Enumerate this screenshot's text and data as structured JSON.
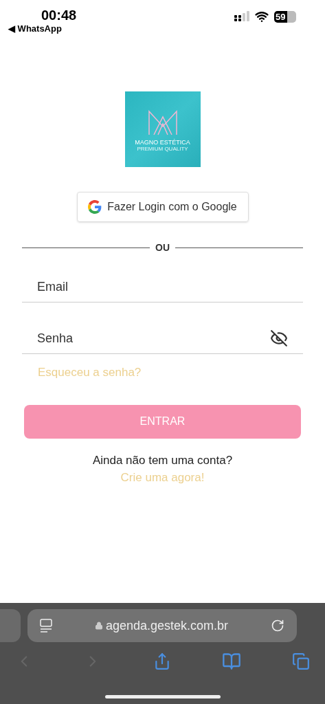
{
  "status_bar": {
    "time": "00:48",
    "back_app": "◀ WhatsApp",
    "battery": "59"
  },
  "logo": {
    "name": "MAGNO ESTÉTICA",
    "tagline": "PREMIUM QUALITY"
  },
  "google_button": {
    "label": "Fazer Login com o Google"
  },
  "divider": {
    "label": "OU"
  },
  "email_field": {
    "placeholder": "Email"
  },
  "password_field": {
    "placeholder": "Senha",
    "password_visible": false
  },
  "forgot_link": "Esqueceu a senha?",
  "submit_button": {
    "label": "ENTRAR",
    "disabled": true
  },
  "signup": {
    "prompt": "Ainda não tem uma conta?",
    "link": "Crie uma agora!"
  },
  "browser": {
    "url": "agenda.gestek.com.br",
    "back_enabled": false,
    "forward_enabled": false
  }
}
